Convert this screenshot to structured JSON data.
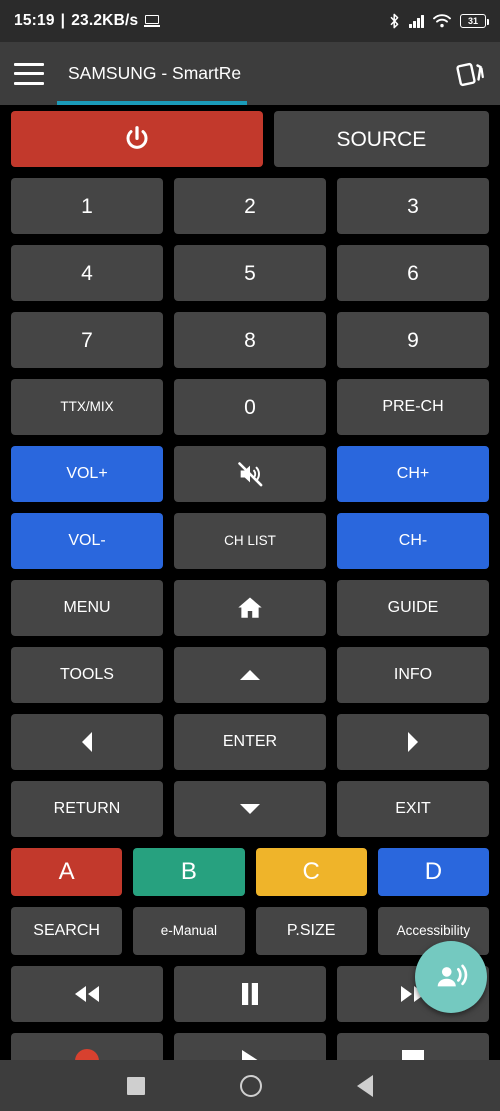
{
  "statusbar": {
    "time": "15:19",
    "separator": "|",
    "network_speed": "23.2KB/s",
    "laptop_icon": "laptop-icon",
    "bluetooth_icon": "bluetooth-icon",
    "signal_icon": "cellular-signal-icon",
    "wifi_icon": "wifi-icon",
    "battery_level": "31",
    "battery_icon": "battery-icon"
  },
  "appbar": {
    "menu_icon": "hamburger-menu-icon",
    "title": "SAMSUNG - SmartRe",
    "action_icon": "card-stack-icon",
    "accent_color": "#1b9ab8"
  },
  "colors": {
    "button_default": "#454545",
    "power_red": "#c2392c",
    "vol_ch_blue": "#2a67dd",
    "color_a": "#c2392c",
    "color_b": "#27a17f",
    "color_c": "#efb42a",
    "color_d": "#2a67dd",
    "fab_teal": "#74c9c0",
    "background": "#000000"
  },
  "remote": {
    "rows": [
      {
        "name": "power-row",
        "buttons": [
          {
            "name": "power-button",
            "label": "",
            "icon": "power-icon",
            "style": "red"
          },
          {
            "name": "source-button",
            "label": "SOURCE",
            "icon": "",
            "style": "default"
          }
        ]
      },
      {
        "name": "numeric-row-1",
        "buttons": [
          {
            "name": "digit-1-button",
            "label": "1",
            "icon": "",
            "style": "default"
          },
          {
            "name": "digit-2-button",
            "label": "2",
            "icon": "",
            "style": "default"
          },
          {
            "name": "digit-3-button",
            "label": "3",
            "icon": "",
            "style": "default"
          }
        ]
      },
      {
        "name": "numeric-row-2",
        "buttons": [
          {
            "name": "digit-4-button",
            "label": "4",
            "icon": "",
            "style": "default"
          },
          {
            "name": "digit-5-button",
            "label": "5",
            "icon": "",
            "style": "default"
          },
          {
            "name": "digit-6-button",
            "label": "6",
            "icon": "",
            "style": "default"
          }
        ]
      },
      {
        "name": "numeric-row-3",
        "buttons": [
          {
            "name": "digit-7-button",
            "label": "7",
            "icon": "",
            "style": "default"
          },
          {
            "name": "digit-8-button",
            "label": "8",
            "icon": "",
            "style": "default"
          },
          {
            "name": "digit-9-button",
            "label": "9",
            "icon": "",
            "style": "default"
          }
        ]
      },
      {
        "name": "numeric-row-4",
        "buttons": [
          {
            "name": "ttx-mix-button",
            "label": "TTX/MIX",
            "icon": "",
            "style": "small"
          },
          {
            "name": "digit-0-button",
            "label": "0",
            "icon": "",
            "style": "default"
          },
          {
            "name": "pre-ch-button",
            "label": "PRE-CH",
            "icon": "",
            "style": "default"
          }
        ]
      },
      {
        "name": "volume-row-1",
        "buttons": [
          {
            "name": "volume-up-button",
            "label": "VOL+",
            "icon": "",
            "style": "blue"
          },
          {
            "name": "mute-button",
            "label": "",
            "icon": "mute-icon",
            "style": "default"
          },
          {
            "name": "channel-up-button",
            "label": "CH+",
            "icon": "",
            "style": "blue"
          }
        ]
      },
      {
        "name": "volume-row-2",
        "buttons": [
          {
            "name": "volume-down-button",
            "label": "VOL-",
            "icon": "",
            "style": "blue"
          },
          {
            "name": "channel-list-button",
            "label": "CH LIST",
            "icon": "",
            "style": "small"
          },
          {
            "name": "channel-down-button",
            "label": "CH-",
            "icon": "",
            "style": "blue"
          }
        ]
      },
      {
        "name": "menu-row",
        "buttons": [
          {
            "name": "menu-button",
            "label": "MENU",
            "icon": "",
            "style": "default"
          },
          {
            "name": "home-button",
            "label": "",
            "icon": "home-icon",
            "style": "default"
          },
          {
            "name": "guide-button",
            "label": "GUIDE",
            "icon": "",
            "style": "default"
          }
        ]
      },
      {
        "name": "tools-row",
        "buttons": [
          {
            "name": "tools-button",
            "label": "TOOLS",
            "icon": "",
            "style": "default"
          },
          {
            "name": "dpad-up-button",
            "label": "",
            "icon": "arrow-up-icon",
            "style": "default"
          },
          {
            "name": "info-button",
            "label": "INFO",
            "icon": "",
            "style": "default"
          }
        ]
      },
      {
        "name": "dpad-row",
        "buttons": [
          {
            "name": "dpad-left-button",
            "label": "",
            "icon": "arrow-left-icon",
            "style": "default"
          },
          {
            "name": "enter-button",
            "label": "ENTER",
            "icon": "",
            "style": "default"
          },
          {
            "name": "dpad-right-button",
            "label": "",
            "icon": "arrow-right-icon",
            "style": "default"
          }
        ]
      },
      {
        "name": "return-row",
        "buttons": [
          {
            "name": "return-button",
            "label": "RETURN",
            "icon": "",
            "style": "default"
          },
          {
            "name": "dpad-down-button",
            "label": "",
            "icon": "arrow-down-icon",
            "style": "default"
          },
          {
            "name": "exit-button",
            "label": "EXIT",
            "icon": "",
            "style": "default"
          }
        ]
      },
      {
        "name": "color-row",
        "buttons": [
          {
            "name": "color-a-button",
            "label": "A",
            "icon": "",
            "style": "red"
          },
          {
            "name": "color-b-button",
            "label": "B",
            "icon": "",
            "style": "green"
          },
          {
            "name": "color-c-button",
            "label": "C",
            "icon": "",
            "style": "amber"
          },
          {
            "name": "color-d-button",
            "label": "D",
            "icon": "",
            "style": "blue"
          }
        ]
      },
      {
        "name": "feature-row",
        "buttons": [
          {
            "name": "search-button",
            "label": "SEARCH",
            "icon": "",
            "style": "medium"
          },
          {
            "name": "e-manual-button",
            "label": "e-Manual",
            "icon": "",
            "style": "small"
          },
          {
            "name": "picture-size-button",
            "label": "P.SIZE",
            "icon": "",
            "style": "medium"
          },
          {
            "name": "accessibility-button",
            "label": "Accessibility",
            "icon": "",
            "style": "small"
          }
        ]
      },
      {
        "name": "transport-row-1",
        "buttons": [
          {
            "name": "rewind-button",
            "label": "",
            "icon": "rewind-icon",
            "style": "default"
          },
          {
            "name": "pause-button",
            "label": "",
            "icon": "pause-icon",
            "style": "default"
          },
          {
            "name": "fast-forward-button",
            "label": "",
            "icon": "fast-forward-icon",
            "style": "default"
          }
        ]
      },
      {
        "name": "transport-row-2",
        "buttons": [
          {
            "name": "record-button",
            "label": "",
            "icon": "record-icon",
            "style": "default"
          },
          {
            "name": "play-button",
            "label": "",
            "icon": "play-icon",
            "style": "default"
          },
          {
            "name": "stop-button",
            "label": "",
            "icon": "stop-icon",
            "style": "default"
          }
        ]
      }
    ]
  },
  "fab": {
    "name": "voice-command-fab",
    "icon": "record-voice-over-icon"
  },
  "navbar": {
    "recents_icon": "recents-square-icon",
    "home_icon": "home-circle-icon",
    "back_icon": "back-triangle-icon"
  }
}
